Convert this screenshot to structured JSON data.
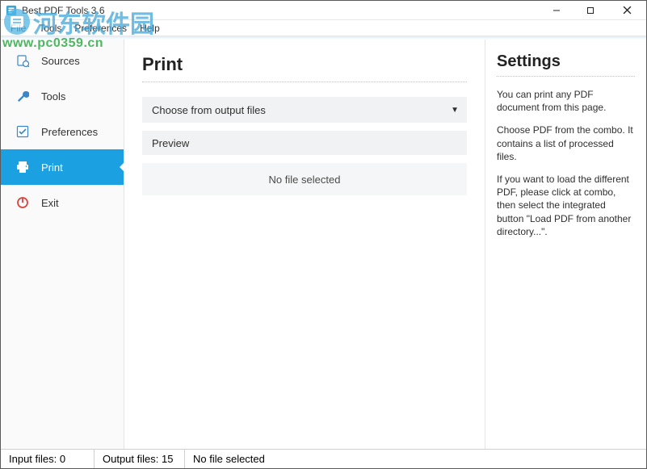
{
  "window": {
    "title": "Best PDF Tools 3.6"
  },
  "menu": {
    "file": "File",
    "tools": "Tools",
    "preferences": "Preferences",
    "help": "Help"
  },
  "sidebar": {
    "items": [
      {
        "label": "Sources"
      },
      {
        "label": "Tools"
      },
      {
        "label": "Preferences"
      },
      {
        "label": "Print"
      },
      {
        "label": "Exit"
      }
    ]
  },
  "main": {
    "title": "Print",
    "combo_label": "Choose from output files",
    "preview_header": "Preview",
    "preview_empty": "No file selected"
  },
  "settings": {
    "title": "Settings",
    "p1": "You can print any PDF document from this page.",
    "p2": "Choose PDF from the combo. It contains a list of processed files.",
    "p3": "If you want to load the different PDF, please click at combo, then select the integrated button \"Load PDF from another directory...\"."
  },
  "status": {
    "input": "Input files: 0",
    "output": "Output files: 15",
    "msg": "No file selected"
  },
  "watermark": {
    "cn": "河东软件园",
    "url": "www.pc0359.cn"
  }
}
